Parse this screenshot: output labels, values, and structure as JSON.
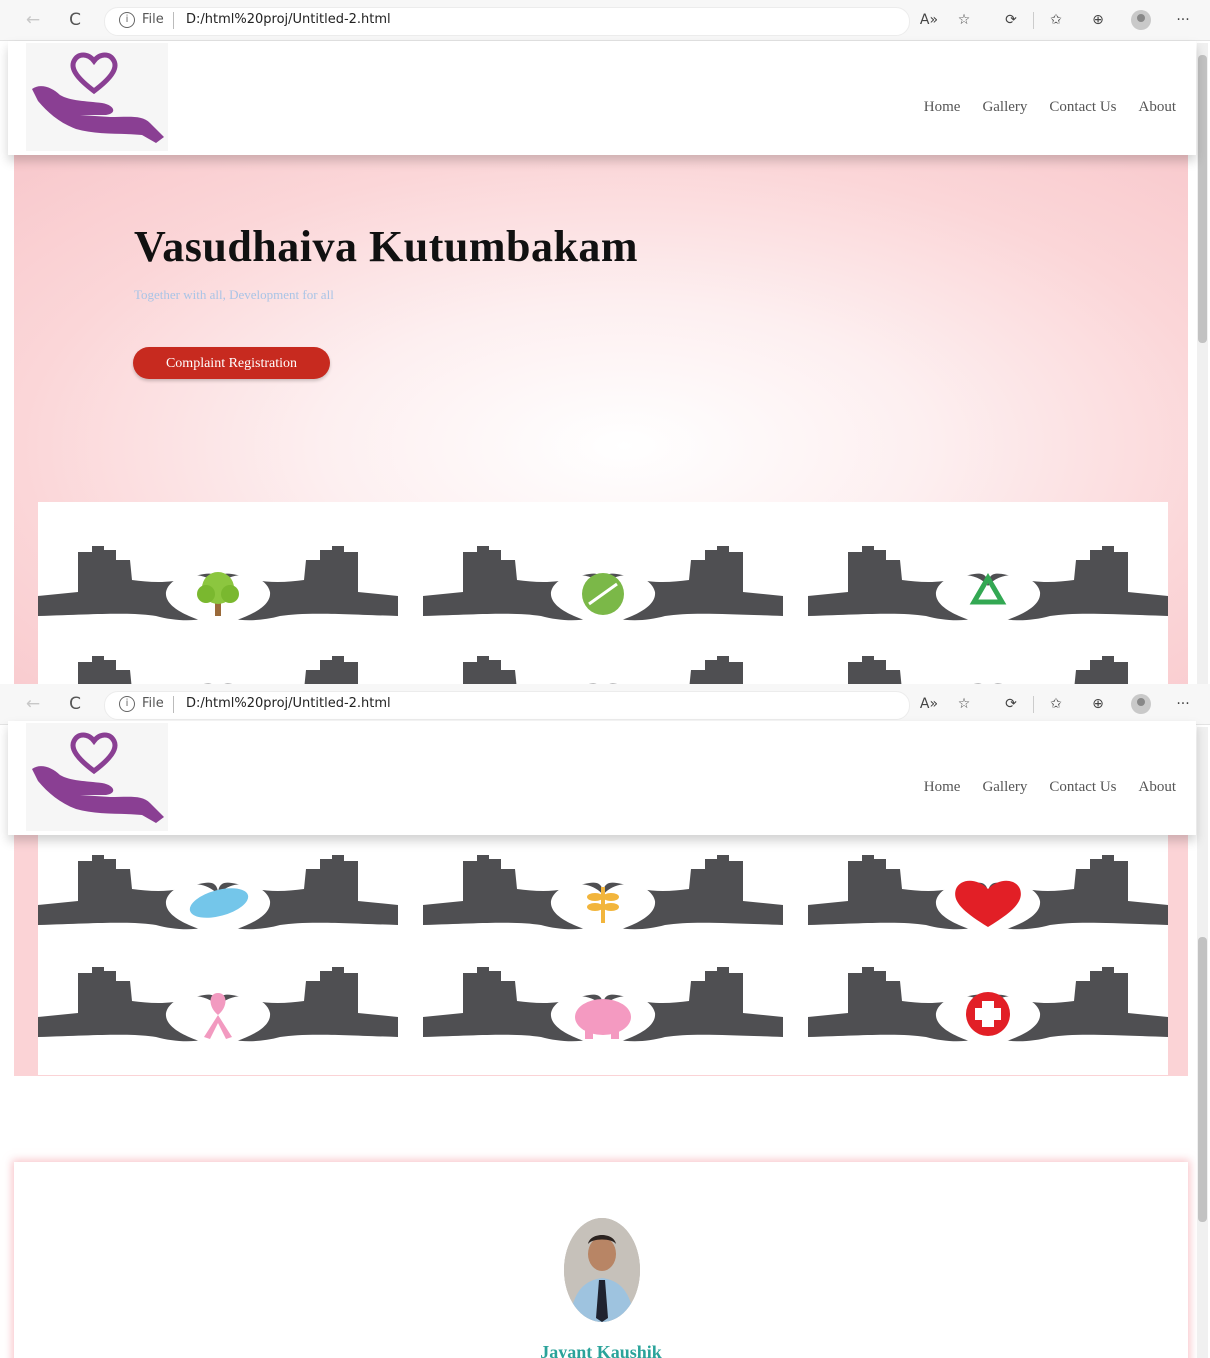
{
  "browser": {
    "file_label": "File",
    "url": "D:/html%20proj/Untitled-2.html",
    "back_icon": "←",
    "reload_icon": "C",
    "info_icon": "i",
    "read_aloud_icon": "A»",
    "add_favorite_icon": "☆",
    "extensions_icon": "⟳",
    "favorites_icon": "✩",
    "collections_icon": "⊕",
    "more_icon": "···"
  },
  "header": {
    "nav": [
      "Home",
      "Gallery",
      "Contact Us",
      "About"
    ],
    "logo_color": "#8a3f93"
  },
  "hero": {
    "title": "Vasudhaiva Kutumbakam",
    "subtitle": "Together with all, Development for all",
    "cta_label": "Complaint Registration",
    "cta_color": "#c72a1f"
  },
  "gallery": {
    "hands_color": "#4f4f52",
    "icons_top": [
      "tree-icon",
      "leaf-icon",
      "recycle-icon"
    ],
    "icons_bottom_row1": [
      "pills-icon",
      "wheat-icon",
      "heart-icon"
    ],
    "icons_bottom_row2": [
      "ribbon-icon",
      "piggy-bank-icon",
      "medical-cross-icon"
    ]
  },
  "profile": {
    "name": "Jayant Kaushik",
    "name_color": "#2aa39a"
  }
}
